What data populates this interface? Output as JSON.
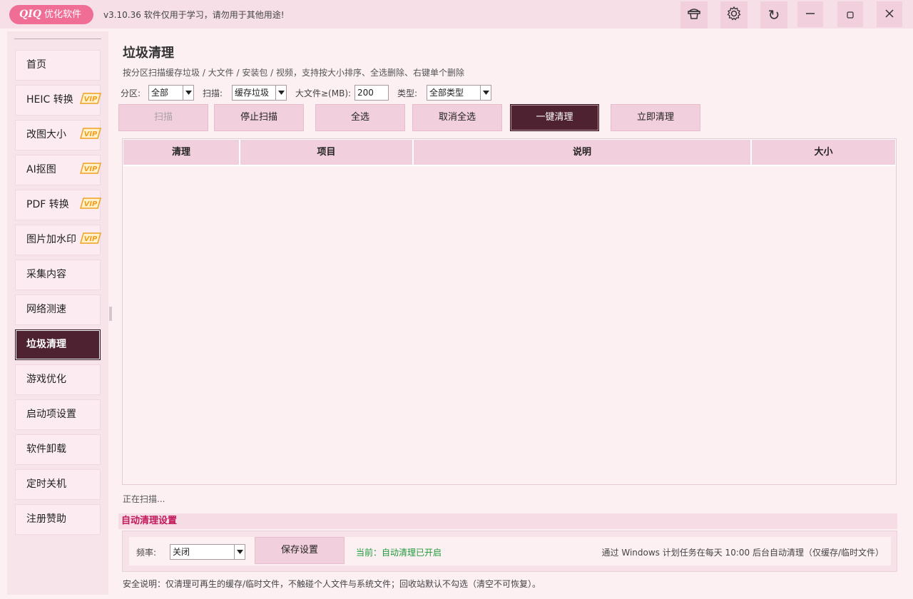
{
  "app": {
    "logo_brand": "QIQ",
    "logo_text": "优化软件",
    "version_text": "v3.10.36 软件仅用于学习，请勿用于其他用途!"
  },
  "titlebar": {
    "icons": [
      "hat-icon",
      "gear-icon",
      "refresh-icon",
      "minimize-icon",
      "maximize-icon",
      "close-icon"
    ]
  },
  "sidebar": {
    "items": [
      {
        "label": "首页",
        "vip": false
      },
      {
        "label": "HEIC 转换",
        "vip": true
      },
      {
        "label": "改图大小",
        "vip": true
      },
      {
        "label": "AI抠图",
        "vip": true
      },
      {
        "label": "PDF 转换",
        "vip": true
      },
      {
        "label": "图片加水印",
        "vip": true
      },
      {
        "label": "采集内容",
        "vip": false
      },
      {
        "label": "网络测速",
        "vip": false
      },
      {
        "label": "垃圾清理",
        "vip": false,
        "active": true
      },
      {
        "label": "游戏优化",
        "vip": false
      },
      {
        "label": "启动项设置",
        "vip": false
      },
      {
        "label": "软件卸载",
        "vip": false
      },
      {
        "label": "定时关机",
        "vip": false
      },
      {
        "label": "注册赞助",
        "vip": false
      }
    ],
    "vip_label": "VIP"
  },
  "main": {
    "title": "垃圾清理",
    "description": "按分区扫描缓存垃圾 / 大文件 / 安装包 / 视频，支持按大小排序、全选删除、右键单个删除",
    "filters": {
      "partition_label": "分区:",
      "partition_value": "全部",
      "scan_label": "扫描:",
      "scan_value": "缓存垃圾",
      "bigfile_label": "大文件≥(MB):",
      "bigfile_value": "200",
      "type_label": "类型:",
      "type_value": "全部类型"
    },
    "buttons": {
      "scan": "扫描",
      "stop_scan": "停止扫描",
      "select_all": "全选",
      "deselect_all": "取消全选",
      "one_click_clean": "一键清理",
      "clean_now": "立即清理"
    },
    "table": {
      "columns": [
        "清理",
        "项目",
        "说明",
        "大小"
      ],
      "rows": []
    },
    "status_text": "正在扫描...",
    "auto": {
      "heading": "自动清理设置",
      "freq_label": "频率:",
      "freq_value": "关闭",
      "save_button": "保存设置",
      "current_text": "当前：自动清理已开启",
      "schedule_text": "通过 Windows 计划任务在每天 10:00 后台自动清理（仅缓存/临时文件）"
    },
    "safety_note": "安全说明：仅清理可再生的缓存/临时文件，不触碰个人文件与系统文件；回收站默认不勾选（清空不可恢复）。"
  },
  "colors": {
    "accent_dark": "#4e2230",
    "button_pink": "#f2cfdc",
    "logo_pink": "#f06e96",
    "vip_orange": "#f0a020",
    "heading_red": "#c2185b",
    "status_green": "#1f9a3a"
  }
}
